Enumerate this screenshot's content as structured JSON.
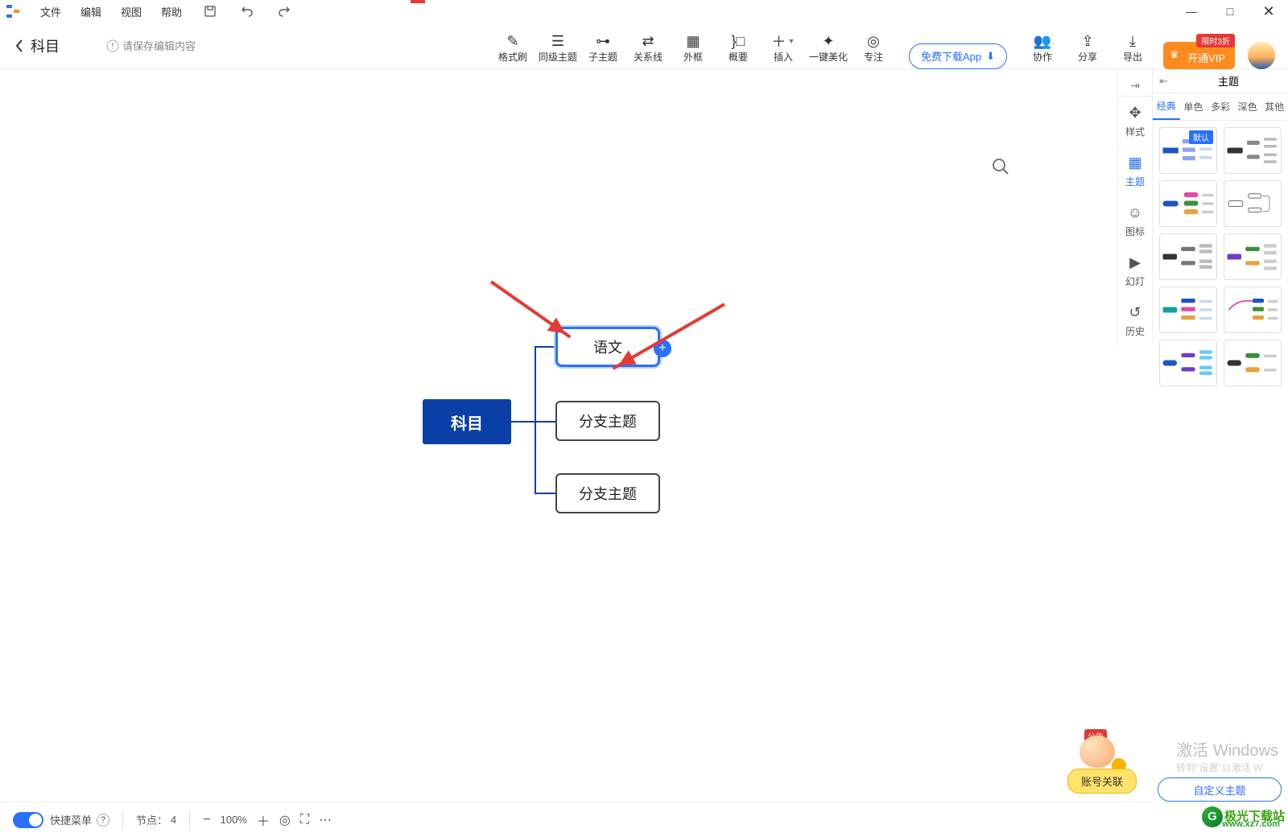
{
  "menu": {
    "file": "文件",
    "edit": "编辑",
    "view": "视图",
    "help": "帮助"
  },
  "window_controls": {
    "min": "—",
    "max": "□",
    "close": "✕"
  },
  "title": "科目",
  "unsaved_hint": "请保存编辑内容",
  "toolbar": {
    "format": "格式刷",
    "peer": "同级主题",
    "child": "子主题",
    "relation": "关系线",
    "frame": "外框",
    "summary": "概要",
    "insert": "插入",
    "beautify": "一键美化",
    "focus": "专注",
    "download": "免费下载App",
    "collab": "协作",
    "share": "分享",
    "export": "导出"
  },
  "vip": {
    "top": "限时3折",
    "label": "开通VIP"
  },
  "mindmap": {
    "root": "科目",
    "child1": "语文",
    "child2": "分支主题",
    "child3": "分支主题"
  },
  "siderail": {
    "style": "样式",
    "theme": "主题",
    "icon": "图标",
    "slide": "幻灯",
    "history": "历史"
  },
  "panel": {
    "title": "主题",
    "tabs": {
      "classic": "经典",
      "single": "单色",
      "multi": "多彩",
      "dark": "深色",
      "other": "其他"
    },
    "default_tag": "默认"
  },
  "status": {
    "quickmenu": "快捷菜单",
    "nodes_label": "节点：",
    "nodes_count": "4",
    "zoom": "100%"
  },
  "account_link": "账号关联",
  "mascot_label": "公告",
  "custom_btn": "自定义主题",
  "watermark": {
    "win": "激活 Windows",
    "win_sub": "转到\"设置\"以激活 W",
    "site": "极光下载站",
    "url": "www.xz7.com"
  }
}
